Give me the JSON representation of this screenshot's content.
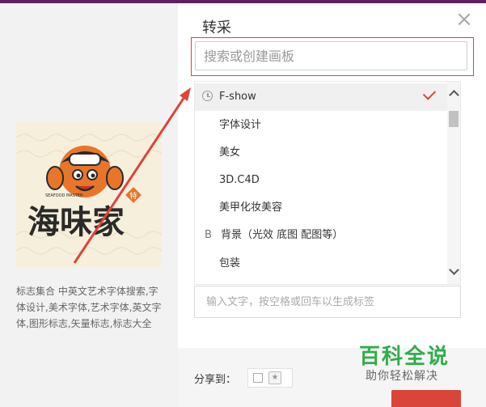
{
  "left": {
    "description": "标志集合 中英文艺术字体搜索,字体设计,美术字体,艺术字体,英文字体,图形标志,矢量标志,标志大全",
    "logo_text": "海味家",
    "logo_sub": "SEAFOOD MASTER",
    "logo_stamp": "特"
  },
  "dialog": {
    "title": "转采",
    "close_icon": "close-icon",
    "search_placeholder": "搜索或创建画板",
    "boards": [
      {
        "prefix": "",
        "label": "F-show",
        "icon": "clock-icon",
        "selected": true
      },
      {
        "prefix": "",
        "label": "字体设计"
      },
      {
        "prefix": "",
        "label": "美女"
      },
      {
        "prefix": "",
        "label": "3D.C4D"
      },
      {
        "prefix": "",
        "label": "美甲化妆美容"
      },
      {
        "prefix": "B",
        "label": "背景（光效 底图 配图等）"
      },
      {
        "prefix": "",
        "label": "包装"
      }
    ],
    "tag_placeholder": "输入文字，按空格或回车以生成标签",
    "share_label": "分享到：",
    "share_icon": "weibo-icon"
  },
  "watermark": {
    "title": "百科全说",
    "subtitle": "助你轻松解决"
  },
  "colors": {
    "accent_red": "#d9453b",
    "check_red": "#e0443a",
    "watermark_green": "#2fae4a",
    "top_bar": "#5b2160"
  }
}
